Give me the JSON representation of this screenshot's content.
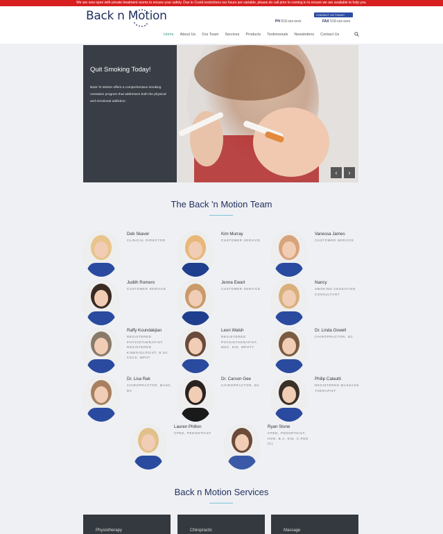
{
  "notice_bar": {
    "text": "We are now open with private treatment rooms to ensure your safety. Due to Covid restrictions our hours are variable, please do call prior to coming in to ensure we are available to help you."
  },
  "header": {
    "logo_text": "Back n Motion",
    "contact_badge": "CONTACT US TODAY!",
    "phone_label": "PH",
    "phone_value": "519-xxx-xxxx",
    "fax_label": "FAX",
    "fax_value": "519-xxx-xxxx",
    "nav": [
      "Home",
      "About Us",
      "Our Team",
      "Services",
      "Products",
      "Testimonials",
      "Newsletters",
      "Contact Us"
    ]
  },
  "hero": {
    "title": "Quit Smoking Today!",
    "text": "Back 'N Motion offers a comprehensive smoking cessation program that addresses both the physical and emotional addiction."
  },
  "team": {
    "title": "The Back 'n Motion Team",
    "members": [
      {
        "name": "Deb Skaver",
        "role": "CLINICAL DIRECTOR"
      },
      {
        "name": "Kim Murray",
        "role": "CUSTOMER SERVICE"
      },
      {
        "name": "Vanessa James",
        "role": "CUSTOMER SERVICE"
      },
      {
        "name": "Judith Romero",
        "role": "CUSTOMER SERVICE"
      },
      {
        "name": "Jenna Ewart",
        "role": "CUSTOMER SERVICE"
      },
      {
        "name": "Nancy",
        "role": "SMOKING CESSATION CONSULTANT"
      },
      {
        "name": "Raffy Koundakjian",
        "role": "REGISTERED PHYSIOTHERAPIST, REGISTERED KINESIOLOGIST, B.SC. CSCS, MPHT"
      },
      {
        "name": "Leon Walsh",
        "role": "REGISTERED PHYSIOTHERAPIST, MSC. KIN. MPHTY"
      },
      {
        "name": "Dr. Linda Oswell",
        "role": "CHIROPRACTOR, DC"
      },
      {
        "name": "Dr. Lisa Rak",
        "role": "CHIROPRACTOR, MASC, DC"
      },
      {
        "name": "Dr. Carson Gee",
        "role": "CHIROPRACTOR, DC"
      },
      {
        "name": "Philip Calautti",
        "role": "REGISTERED MASSAGE THERAPIST"
      },
      {
        "name": "Lauren Phillon",
        "role": "CPED, PEDORTHIST"
      },
      {
        "name": "Ryan Stone",
        "role": "CPED, PEDORTHIST, HON. B.A. KIN, C.PED (C)"
      }
    ]
  },
  "services": {
    "title": "Back n Motion Services",
    "cards": [
      "Physiotherapy",
      "Chiropractic",
      "Massage"
    ]
  },
  "colors": {
    "accent": "#3a9e8a",
    "brand": "#24305e",
    "notice": "#d71f1f"
  }
}
